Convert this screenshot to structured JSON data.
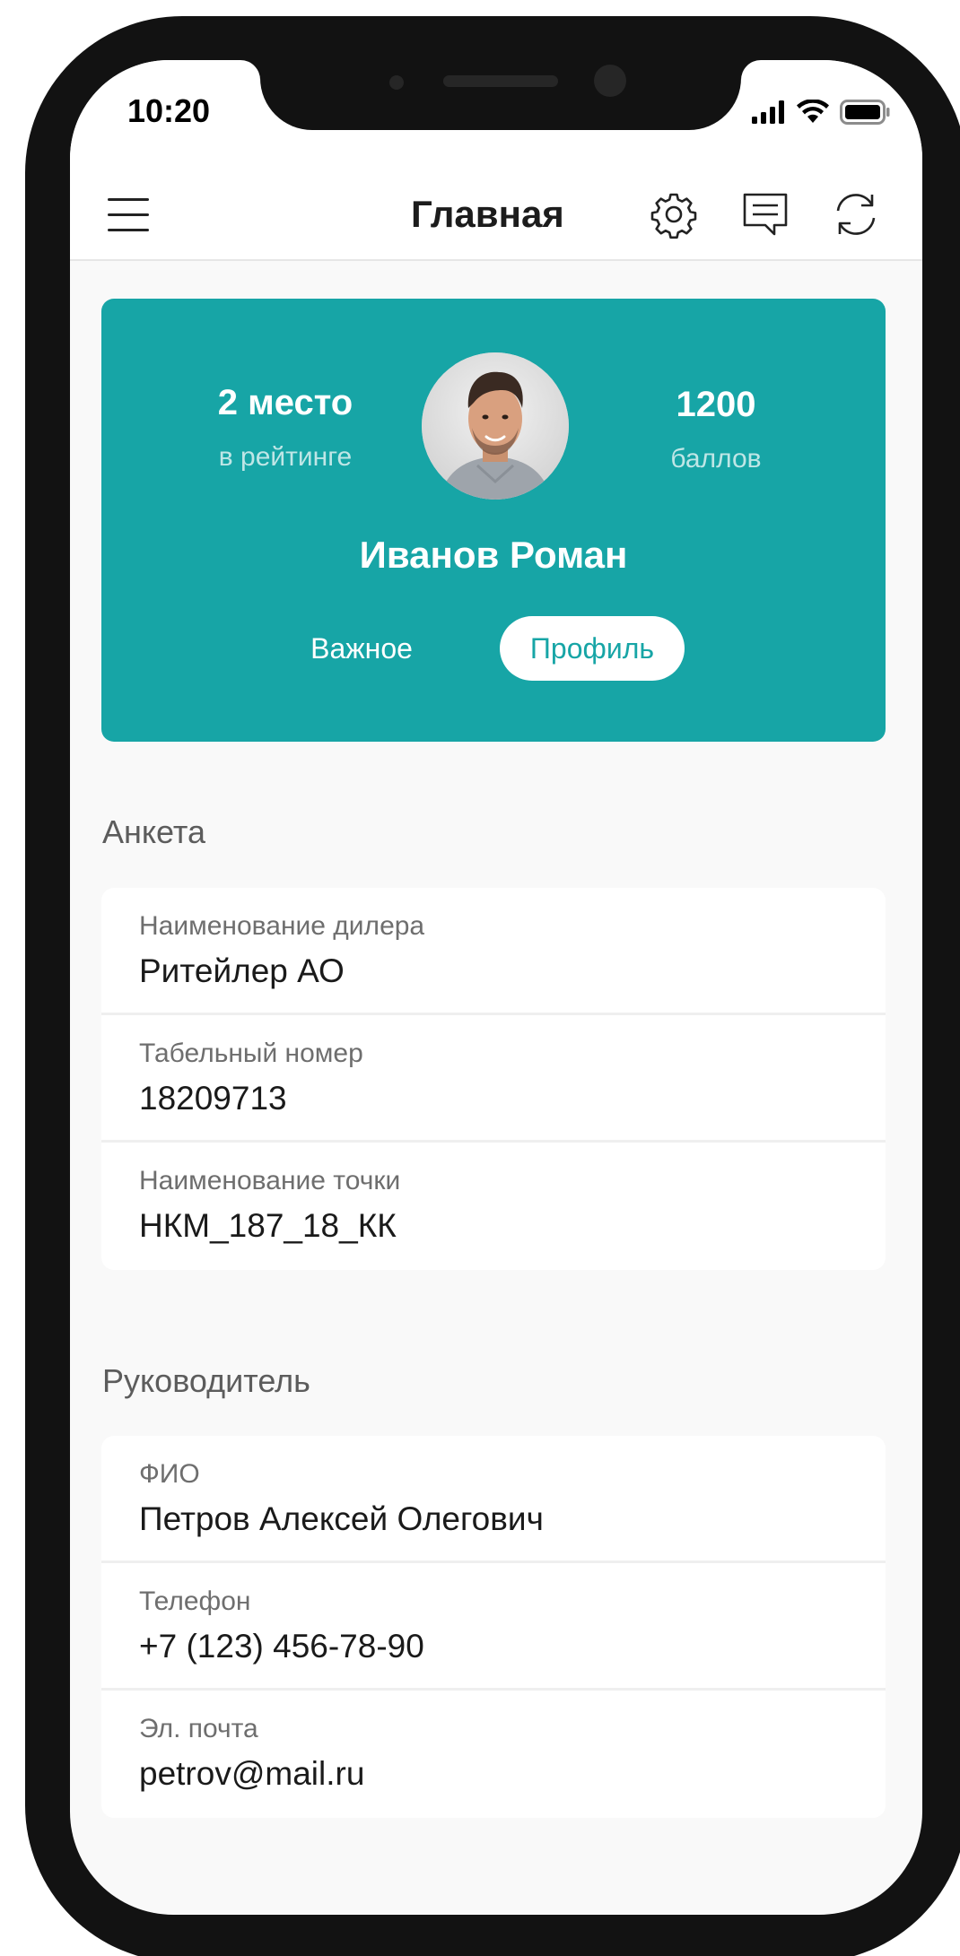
{
  "status_bar": {
    "time": "10:20"
  },
  "nav": {
    "title": "Главная"
  },
  "profile": {
    "rank_value": "2 место",
    "rank_label": "в рейтинге",
    "points_value": "1200",
    "points_label": "баллов",
    "name": "Иванов Роман",
    "tabs": [
      {
        "label": "Важное",
        "active": false
      },
      {
        "label": "Профиль",
        "active": true
      }
    ]
  },
  "anketa": {
    "title": "Анкета",
    "rows": [
      {
        "label": "Наименование дилера",
        "value": "Ритейлер АО"
      },
      {
        "label": "Табельный номер",
        "value": "18209713"
      },
      {
        "label": "Наименование точки",
        "value": "НКМ_187_18_КК"
      }
    ]
  },
  "manager": {
    "title": "Руководитель",
    "rows": [
      {
        "label": "ФИО",
        "value": "Петров Алексей Олегович"
      },
      {
        "label": "Телефон",
        "value": "+7 (123) 456-78-90"
      },
      {
        "label": "Эл. почта",
        "value": "petrov@mail.ru"
      }
    ]
  },
  "colors": {
    "accent": "#17a5a6",
    "background": "#f9f9f9",
    "frame": "#121212"
  },
  "icons": [
    "menu-icon",
    "gear-icon",
    "message-icon",
    "refresh-icon",
    "signal-icon",
    "wifi-icon",
    "battery-icon"
  ]
}
